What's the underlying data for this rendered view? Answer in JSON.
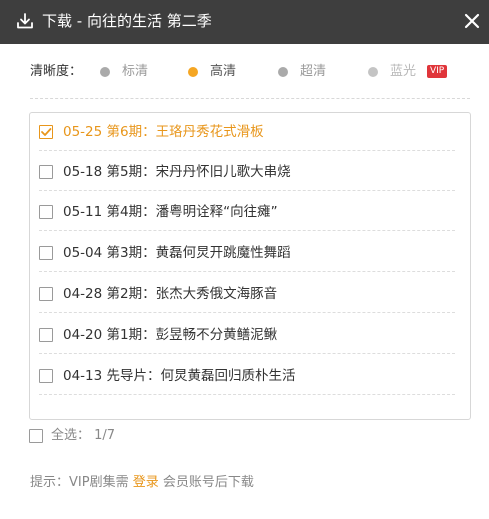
{
  "window": {
    "title": "下载 - 向往的生活 第二季",
    "download_icon": "download-icon",
    "close_icon": "close-icon"
  },
  "quality": {
    "label": "清晰度：",
    "options": [
      {
        "label": "标清",
        "state": "normal"
      },
      {
        "label": "高清",
        "state": "selected"
      },
      {
        "label": "超清",
        "state": "normal"
      },
      {
        "label": "蓝光",
        "state": "disabled",
        "badge": "VIP"
      }
    ]
  },
  "episodes": [
    {
      "text": "05-25 第6期：王珞丹秀花式滑板",
      "checked": true
    },
    {
      "text": "05-18 第5期：宋丹丹怀旧儿歌大串烧",
      "checked": false
    },
    {
      "text": "05-11 第4期：潘粤明诠释“向往瘫”",
      "checked": false
    },
    {
      "text": "05-04 第3期：黄磊何炅开跳魔性舞蹈",
      "checked": false
    },
    {
      "text": "04-28 第2期：张杰大秀俄文海豚音",
      "checked": false
    },
    {
      "text": "04-20 第1期：彭昱畅不分黄鳝泥鳅",
      "checked": false
    },
    {
      "text": "04-13 先导片：何炅黄磊回归质朴生活",
      "checked": false
    }
  ],
  "select_all": {
    "label": "全选：",
    "count": "1/7"
  },
  "hint": {
    "prefix": "提示：VIP剧集需",
    "link": "登录",
    "suffix": "会员账号后下载"
  },
  "colors": {
    "titlebar": "#3e3e3e",
    "accent": "#e8961b",
    "selected_dot": "#f5a623",
    "vip_badge": "#e0353a"
  }
}
